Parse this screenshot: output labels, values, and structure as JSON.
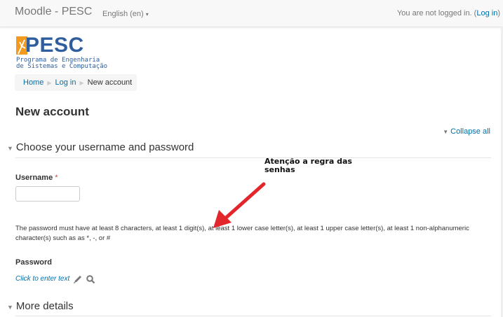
{
  "navbar": {
    "brand": "Moodle - PESC",
    "language": "English (en)",
    "login_status": "You are not logged in. (",
    "login_link": "Log in",
    "login_close": ")"
  },
  "logo": {
    "word": "PESC",
    "subtitle_line1": "Programa de Engenharia",
    "subtitle_line2": "de Sistemas e Computação"
  },
  "breadcrumb": {
    "items": [
      "Home",
      "Log in",
      "New account"
    ]
  },
  "page": {
    "title": "New account",
    "collapse_all": "Collapse all"
  },
  "section_credentials": {
    "title": "Choose your username and password",
    "username_label": "Username",
    "username_value": "",
    "required_marker": "*",
    "password_policy": "The password must have at least 8 characters, at least 1 digit(s), at least 1 lower case letter(s), at least 1 upper case letter(s), at least 1 non-alphanumeric character(s) such as as *, -, or #",
    "password_label": "Password",
    "password_placeholder": "Click to enter text"
  },
  "section_more": {
    "title": "More details"
  },
  "annotation": {
    "text_line1": "Atenção a regra das",
    "text_line2": "senhas"
  },
  "colors": {
    "link": "#0070a8",
    "brand_blue": "#2e5e9e",
    "brand_orange": "#f39a1e",
    "required": "#b94a48",
    "annotation_arrow": "#e3262b"
  }
}
